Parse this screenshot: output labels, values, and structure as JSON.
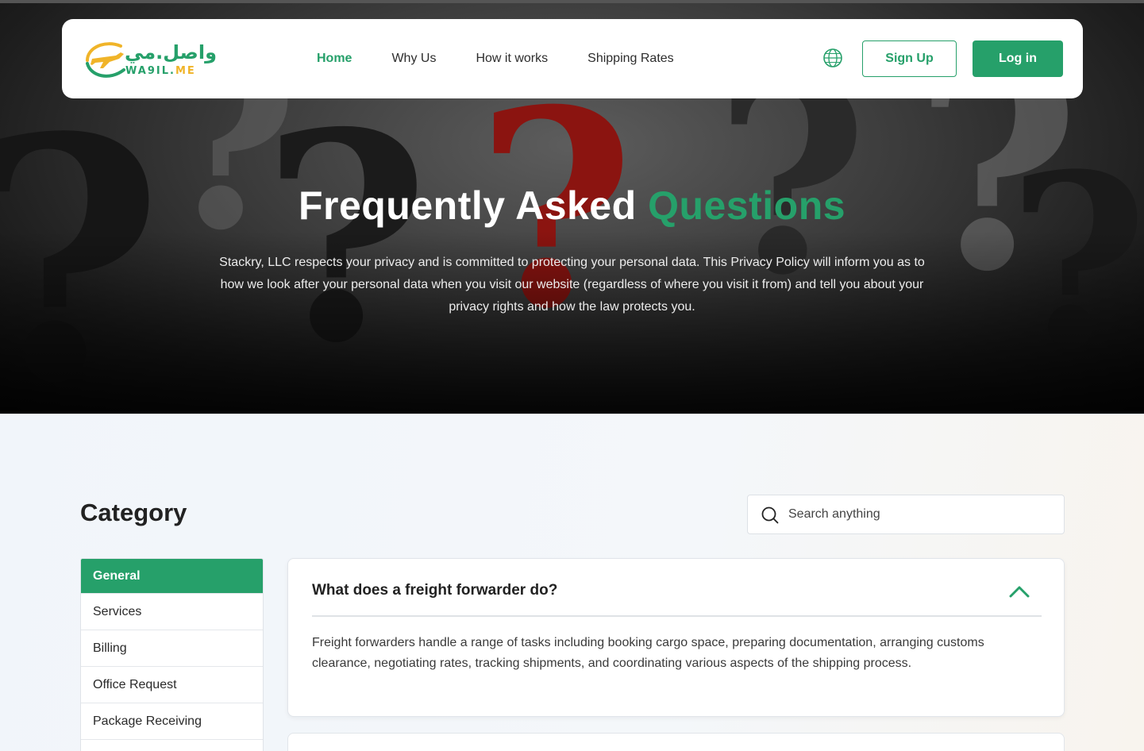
{
  "brand": {
    "arabic": "واصل.مي",
    "latin": "WA9IL",
    "dot": ".",
    "me": "ME"
  },
  "nav": {
    "items": [
      "Home",
      "Why Us",
      "How it works",
      "Shipping Rates"
    ],
    "active": "Home"
  },
  "auth": {
    "signup": "Sign Up",
    "login": "Log in"
  },
  "hero": {
    "title_white": "Frequently Asked",
    "title_green": "Questions",
    "description": "Stackry, LLC respects your privacy and is committed to protecting your personal data. This Privacy Policy will inform you as to how we look after your personal data when you visit our website (regardless of where you visit it from) and tell you about your privacy rights and how the law protects you."
  },
  "category": {
    "title": "Category",
    "items": [
      "General",
      "Services",
      "Billing",
      "Office Request",
      "Package Receiving"
    ],
    "active": "General"
  },
  "search": {
    "placeholder": "Search anything",
    "value": ""
  },
  "faq": {
    "question": "What does a freight forwarder do?",
    "answer": "Freight forwarders handle a range of tasks including booking cargo space, preparing documentation, arranging customs clearance, negotiating rates, tracking shipments, and coordinating various aspects of the shipping process.",
    "expanded": true
  },
  "colors": {
    "accent": "#26a06a",
    "logo_yellow": "#f0b429",
    "hero_dark": "#1d1d1d"
  },
  "icons": {
    "globe": "globe-icon",
    "search": "search-icon",
    "chevron": "chevron-up-icon",
    "plane": "airplane-icon"
  }
}
